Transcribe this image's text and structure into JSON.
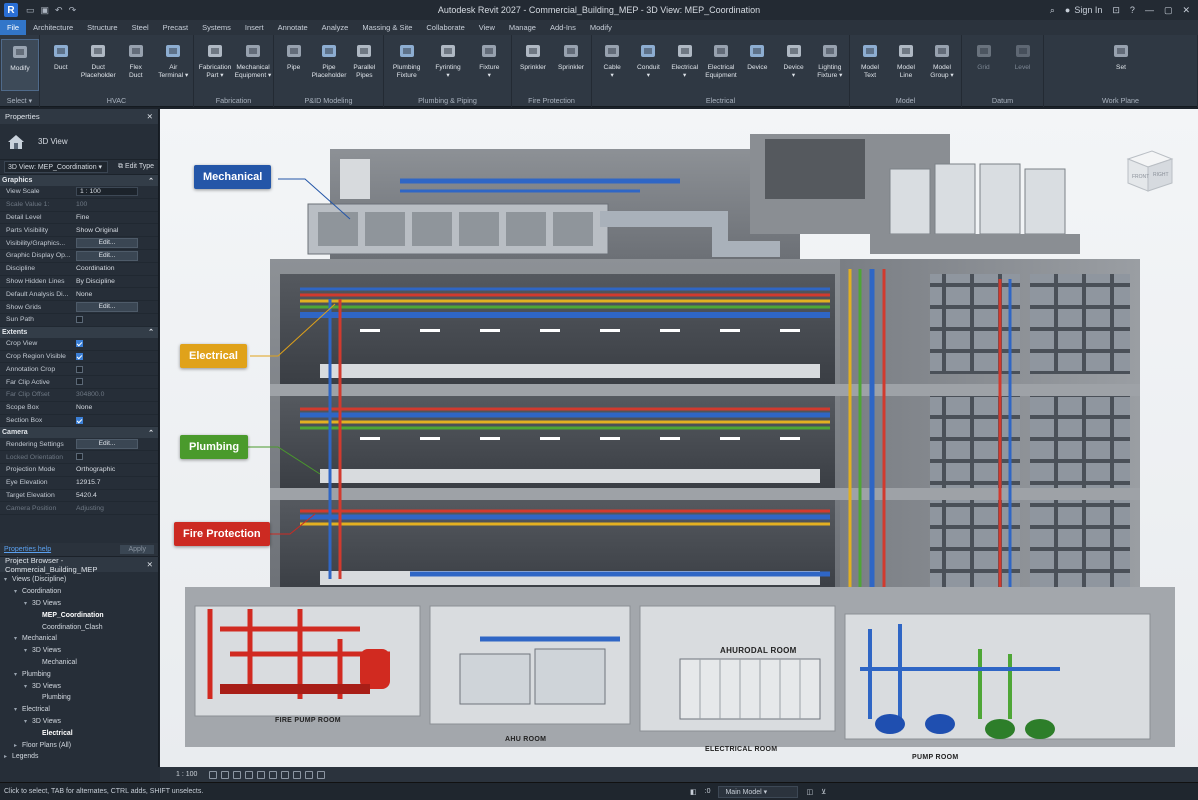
{
  "app": {
    "logo": "R",
    "title": "Autodesk Revit 2027 - Commercial_Building_MEP - 3D View: MEP_Coordination",
    "sign_in": "Sign In",
    "qat_icons": [
      "folder-icon",
      "save-icon",
      "undo-icon",
      "redo-icon"
    ]
  },
  "menu_tabs": [
    "File",
    "Architecture",
    "Structure",
    "Steel",
    "Precast",
    "Systems",
    "Insert",
    "Annotate",
    "Analyze",
    "Massing & Site",
    "Collaborate",
    "View",
    "Manage",
    "Add-Ins",
    "Modify"
  ],
  "active_tab": "File",
  "ribbon": {
    "panels": [
      {
        "title": "Select ▾",
        "buttons": [
          [
            "Modify",
            ""
          ]
        ]
      },
      {
        "title": "HVAC",
        "buttons": [
          [
            "Duct",
            ""
          ],
          [
            "Duct",
            "Placeholder"
          ],
          [
            "Flex",
            "Duct"
          ],
          [
            "Air",
            "Terminal ▾"
          ]
        ]
      },
      {
        "title": "Fabrication",
        "buttons": [
          [
            "Fabrication",
            "Part ▾"
          ],
          [
            "Mechanical",
            "Equipment ▾"
          ]
        ]
      },
      {
        "title": "P&ID Modeling",
        "buttons": [
          [
            "Pipe",
            ""
          ],
          [
            "Pipe",
            "Placeholder"
          ],
          [
            "Parallel",
            "Pipes"
          ]
        ]
      },
      {
        "title": "Plumbing & Piping",
        "buttons": [
          [
            "Plumbing",
            "Fixture"
          ],
          [
            "Fyrinting",
            "▾"
          ],
          [
            "Fixture",
            "▾"
          ]
        ]
      },
      {
        "title": "Fire Protection",
        "buttons": [
          [
            "Sprinkler",
            ""
          ],
          [
            "Sprinkler",
            ""
          ]
        ]
      },
      {
        "title": "Electrical",
        "buttons": [
          [
            "Cable",
            "▾"
          ],
          [
            "Conduit",
            "▾"
          ],
          [
            "Electrical",
            "▾"
          ],
          [
            "Electrical",
            "Equipment"
          ],
          [
            "Device",
            ""
          ],
          [
            "Device",
            "▾"
          ],
          [
            "Lighting",
            "Fixture ▾"
          ]
        ]
      },
      {
        "title": "Model",
        "buttons": [
          [
            "Model",
            "Text"
          ],
          [
            "Model",
            "Line"
          ],
          [
            "Model",
            "Group ▾"
          ]
        ]
      },
      {
        "title": "Datum",
        "buttons": [
          [
            "Grid",
            ""
          ],
          [
            "Level",
            ""
          ]
        ]
      },
      {
        "title": "Work Plane",
        "buttons": [
          [
            "Set",
            ""
          ]
        ]
      }
    ]
  },
  "properties": {
    "title": "Properties",
    "type": "3D View",
    "view_selector": "3D View: MEP_Coordination",
    "edit_type": "Edit Type",
    "sections": [
      {
        "name": "Graphics",
        "rows": [
          {
            "k": "View Scale",
            "v": "1 : 100",
            "kind": "field"
          },
          {
            "k": "Scale Value 1:",
            "v": "100",
            "kind": "gray"
          },
          {
            "k": "Detail Level",
            "v": "Fine",
            "kind": "text"
          },
          {
            "k": "Parts Visibility",
            "v": "Show Original",
            "kind": "text"
          },
          {
            "k": "Visibility/Graphics...",
            "v": "Edit...",
            "kind": "button"
          },
          {
            "k": "Graphic Display Op...",
            "v": "Edit...",
            "kind": "button"
          },
          {
            "k": "Discipline",
            "v": "Coordination",
            "kind": "text"
          },
          {
            "k": "Show Hidden Lines",
            "v": "By Discipline",
            "kind": "text"
          },
          {
            "k": "Default Analysis Di...",
            "v": "None",
            "kind": "text"
          },
          {
            "k": "Show Grids",
            "v": "Edit...",
            "kind": "button"
          },
          {
            "k": "Sun Path",
            "v": "",
            "kind": "check"
          }
        ]
      },
      {
        "name": "Extents",
        "rows": [
          {
            "k": "Crop View",
            "v": "",
            "kind": "check-on"
          },
          {
            "k": "Crop Region Visible",
            "v": "",
            "kind": "check-on"
          },
          {
            "k": "Annotation Crop",
            "v": "",
            "kind": "check"
          },
          {
            "k": "Far Clip Active",
            "v": "",
            "kind": "check"
          },
          {
            "k": "Far Clip Offset",
            "v": "304800.0",
            "kind": "gray"
          },
          {
            "k": "Scope Box",
            "v": "None",
            "kind": "text"
          },
          {
            "k": "Section Box",
            "v": "",
            "kind": "check-on"
          }
        ]
      },
      {
        "name": "Camera",
        "rows": [
          {
            "k": "Rendering Settings",
            "v": "Edit...",
            "kind": "button"
          },
          {
            "k": "Locked Orientation",
            "v": "",
            "kind": "check-gray"
          },
          {
            "k": "Projection Mode",
            "v": "Orthographic",
            "kind": "text"
          },
          {
            "k": "Eye Elevation",
            "v": "12915.7",
            "kind": "text"
          },
          {
            "k": "Target Elevation",
            "v": "5420.4",
            "kind": "text"
          },
          {
            "k": "Camera Position",
            "v": "Adjusting",
            "kind": "gray"
          }
        ]
      }
    ],
    "help_link": "Properties help",
    "apply": "Apply"
  },
  "project_browser": {
    "title": "Project Browser - Commercial_Building_MEP",
    "nodes": [
      {
        "label": "Views (Discipline)",
        "level": 0,
        "twisty": "▾",
        "bold": false
      },
      {
        "label": "Coordination",
        "level": 1,
        "twisty": "▾",
        "bold": false
      },
      {
        "label": "3D Views",
        "level": 2,
        "twisty": "▾",
        "bold": false
      },
      {
        "label": "MEP_Coordination",
        "level": 3,
        "twisty": "",
        "bold": true
      },
      {
        "label": "Coordination_Clash",
        "level": 3,
        "twisty": "",
        "bold": false
      },
      {
        "label": "Mechanical",
        "level": 1,
        "twisty": "▾",
        "bold": false
      },
      {
        "label": "3D Views",
        "level": 2,
        "twisty": "▾",
        "bold": false
      },
      {
        "label": "Mechanical",
        "level": 3,
        "twisty": "",
        "bold": false
      },
      {
        "label": "Plumbing",
        "level": 1,
        "twisty": "▾",
        "bold": false
      },
      {
        "label": "3D Views",
        "level": 2,
        "twisty": "▾",
        "bold": false
      },
      {
        "label": "Plumbing",
        "level": 3,
        "twisty": "",
        "bold": false
      },
      {
        "label": "Electrical",
        "level": 1,
        "twisty": "▾",
        "bold": false
      },
      {
        "label": "3D Views",
        "level": 2,
        "twisty": "▾",
        "bold": false
      },
      {
        "label": "Electrical",
        "level": 3,
        "twisty": "",
        "bold": true
      },
      {
        "label": "Floor Plans (All)",
        "level": 1,
        "twisty": "▸",
        "bold": false
      },
      {
        "label": "Legends",
        "level": 0,
        "twisty": "▸",
        "bold": false
      }
    ]
  },
  "viewport": {
    "callouts": {
      "mechanical": "Mechanical",
      "electrical": "Electrical",
      "plumbing": "Plumbing",
      "fire": "Fire Protection"
    },
    "colors": {
      "mechanical": "#2456a8",
      "electrical": "#e0a21a",
      "plumbing": "#4a9a2c",
      "fire": "#cc2a22"
    },
    "rooms": {
      "fire_pump": "FIRE PUMP ROOM",
      "ahu": "AHU ROOM",
      "electrical_sign": "AHURODAL ROOM",
      "electrical": "ELECTRICAL ROOM",
      "pump": "PUMP ROOM"
    },
    "viewcube": {
      "front": "FRONT",
      "right": "RIGHT"
    }
  },
  "view_bar": {
    "scale": "1 : 100"
  },
  "status": {
    "message": "Click to select, TAB for alternates, CTRL adds, SHIFT unselects.",
    "counter": ":0",
    "model": "Main Model"
  }
}
